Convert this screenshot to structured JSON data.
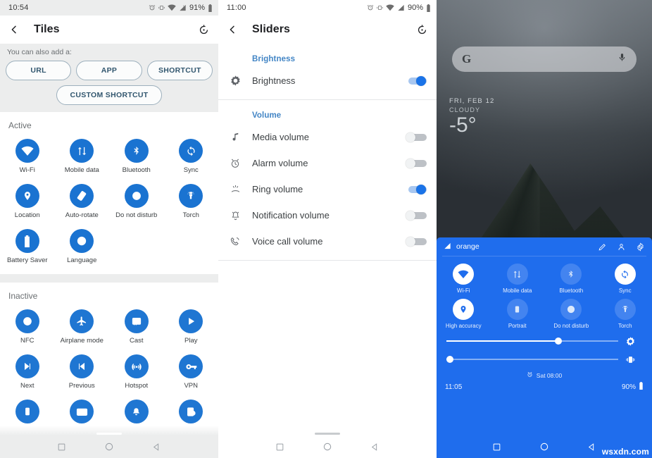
{
  "tiles_screen": {
    "status": {
      "clock": "10:54",
      "battery_pct": "91%"
    },
    "appbar": {
      "title": "Tiles",
      "back_icon": "back-arrow-icon",
      "action_icon": "history-restore-icon"
    },
    "add_section": {
      "label": "You can also add a:",
      "chips": [
        "URL",
        "APP",
        "SHORTCUT"
      ],
      "custom_chip": "CUSTOM SHORTCUT"
    },
    "active": {
      "title": "Active",
      "tiles": [
        {
          "label": "Wi-Fi",
          "icon": "wifi-icon"
        },
        {
          "label": "Mobile data",
          "icon": "mobile-data-icon"
        },
        {
          "label": "Bluetooth",
          "icon": "bluetooth-icon"
        },
        {
          "label": "Sync",
          "icon": "sync-icon"
        },
        {
          "label": "Location",
          "icon": "location-pin-icon"
        },
        {
          "label": "Auto-rotate",
          "icon": "auto-rotate-icon"
        },
        {
          "label": "Do not disturb",
          "icon": "do-not-disturb-icon"
        },
        {
          "label": "Torch",
          "icon": "torch-icon"
        },
        {
          "label": "Battery Saver",
          "icon": "battery-icon"
        },
        {
          "label": "Language",
          "icon": "globe-icon"
        }
      ]
    },
    "inactive": {
      "title": "Inactive",
      "tiles": [
        {
          "label": "NFC",
          "icon": "nfc-icon"
        },
        {
          "label": "Airplane mode",
          "icon": "airplane-icon"
        },
        {
          "label": "Cast",
          "icon": "cast-icon"
        },
        {
          "label": "Play",
          "icon": "play-icon"
        },
        {
          "label": "Next",
          "icon": "next-track-icon"
        },
        {
          "label": "Previous",
          "icon": "previous-track-icon"
        },
        {
          "label": "Hotspot",
          "icon": "hotspot-icon"
        },
        {
          "label": "VPN",
          "icon": "vpn-key-icon"
        },
        {
          "label": "",
          "icon": "phone-icon"
        },
        {
          "label": "",
          "icon": "keyboard-icon"
        },
        {
          "label": "",
          "icon": "bell-icon"
        },
        {
          "label": "",
          "icon": "screenshot-icon"
        }
      ]
    }
  },
  "sliders_screen": {
    "status": {
      "clock": "11:00",
      "battery_pct": "90%"
    },
    "appbar": {
      "title": "Sliders",
      "back_icon": "back-arrow-icon",
      "action_icon": "history-restore-icon"
    },
    "sections": [
      {
        "header": "Brightness",
        "rows": [
          {
            "label": "Brightness",
            "icon": "brightness-icon",
            "on": true
          }
        ]
      },
      {
        "header": "Volume",
        "rows": [
          {
            "label": "Media volume",
            "icon": "music-note-icon",
            "on": false
          },
          {
            "label": "Alarm volume",
            "icon": "alarm-clock-icon",
            "on": false
          },
          {
            "label": "Ring volume",
            "icon": "ring-volume-icon",
            "on": true
          },
          {
            "label": "Notification volume",
            "icon": "notification-bell-icon",
            "on": false
          },
          {
            "label": "Voice call volume",
            "icon": "voice-call-icon",
            "on": false
          }
        ]
      }
    ]
  },
  "home_screen": {
    "status": {
      "clock": "11:05",
      "battery_pct": "90%"
    },
    "search": {
      "logo": "G",
      "mic_icon": "microphone-icon"
    },
    "weather": {
      "date": "FRI, FEB 12",
      "condition": "CLOUDY",
      "temp": "-5°"
    },
    "quick_settings": {
      "carrier": "orange",
      "header_icons": [
        "edit-pencil-icon",
        "user-icon",
        "settings-gear-icon"
      ],
      "tiles": [
        {
          "label": "Wi-Fi",
          "icon": "wifi-icon",
          "on": true
        },
        {
          "label": "Mobile data",
          "icon": "mobile-data-icon",
          "on": false
        },
        {
          "label": "Bluetooth",
          "icon": "bluetooth-icon",
          "on": false
        },
        {
          "label": "Sync",
          "icon": "sync-icon",
          "on": true
        },
        {
          "label": "High accuracy",
          "icon": "location-pin-icon",
          "on": true
        },
        {
          "label": "Portrait",
          "icon": "portrait-icon",
          "on": false
        },
        {
          "label": "Do not disturb",
          "icon": "do-not-disturb-icon",
          "on": false
        },
        {
          "label": "Torch",
          "icon": "torch-icon",
          "on": false
        }
      ],
      "sliders": [
        {
          "name": "brightness",
          "icon": "brightness-icon",
          "value": 65
        },
        {
          "name": "ring-volume",
          "icon": "vibrate-icon",
          "value": 2
        }
      ],
      "alarm": {
        "icon": "alarm-clock-icon",
        "text": "Sat 08:00"
      },
      "footer": {
        "clock": "11:05",
        "battery_pct": "90%"
      }
    }
  },
  "navbar": {
    "recents_icon": "recents-square-icon",
    "home_icon": "home-circle-icon",
    "back_icon": "back-triangle-icon"
  },
  "watermark": "wsxdn.com",
  "colors": {
    "tile_blue": "#1a73d1",
    "qs_blue": "#1f6ded",
    "section_header_blue": "#4285c5",
    "chip_text": "#31566e",
    "switch_on": "#1a73e8"
  }
}
